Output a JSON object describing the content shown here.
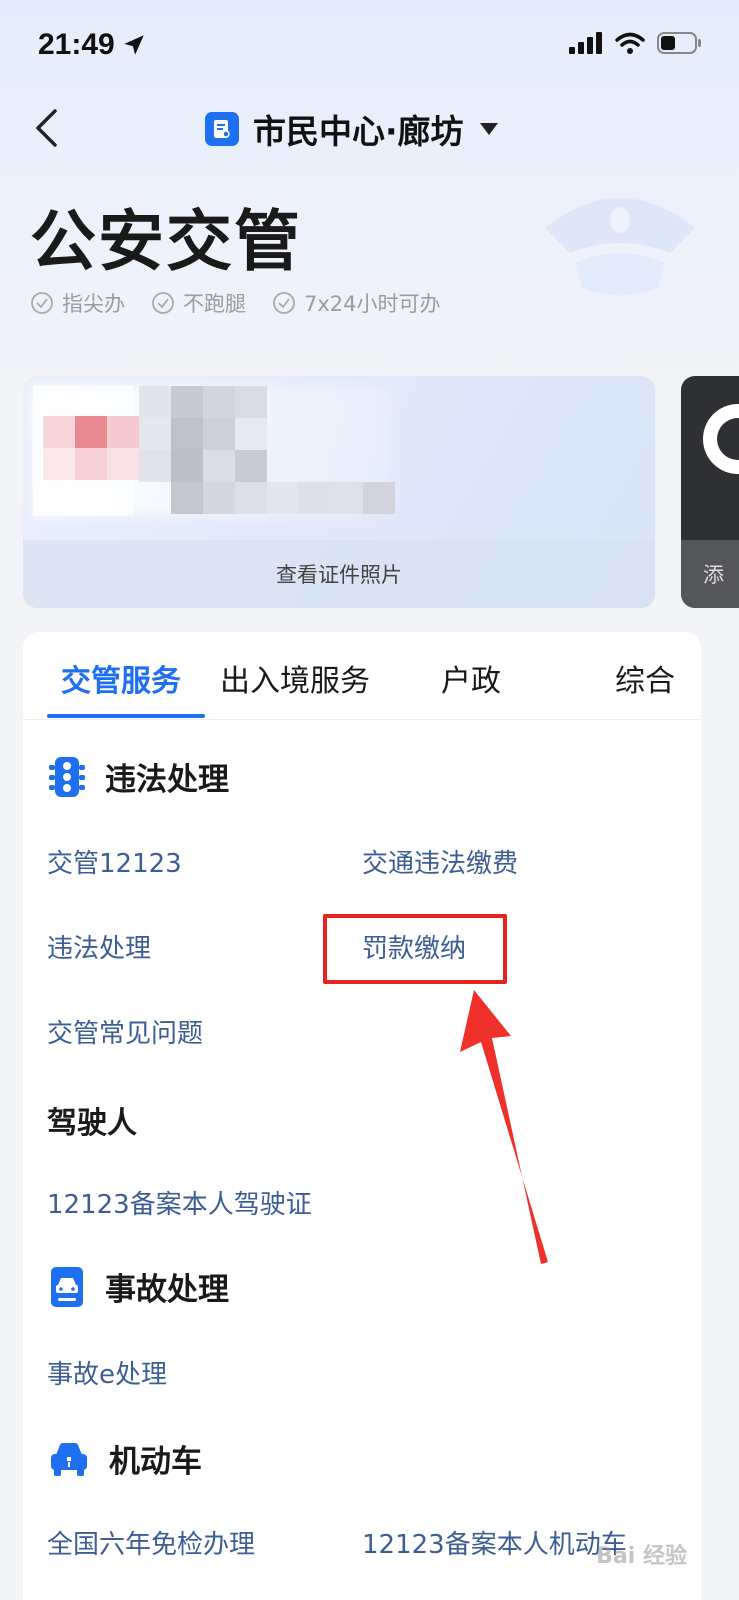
{
  "status_bar": {
    "time": "21:49"
  },
  "nav": {
    "title": "市民中心·廊坊"
  },
  "header": {
    "title": "公安交管",
    "features": [
      "指尖办",
      "不跑腿",
      "7x24小时可办"
    ]
  },
  "cards": {
    "primary_footer": "查看证件照片",
    "secondary_footer": "添"
  },
  "tabs": [
    "交管服务",
    "出入境服务",
    "户政",
    "综合"
  ],
  "sections": {
    "violation": {
      "title": "违法处理",
      "links": [
        "交管12123",
        "交通违法缴费",
        "违法处理",
        "罚款缴纳",
        "交管常见问题"
      ]
    },
    "driver": {
      "title": "驾驶人",
      "links": [
        "12123备案本人驾驶证"
      ]
    },
    "accident": {
      "title": "事故处理",
      "links": [
        "事故e处理"
      ]
    },
    "vehicle": {
      "title": "机动车",
      "links": [
        "全国六年免检办理",
        "12123备案本人机动车"
      ]
    }
  },
  "watermark": "Bai 经验",
  "colors": {
    "accent": "#1f6ff2",
    "link": "#3d5d95",
    "annotation": "#e8231f"
  }
}
